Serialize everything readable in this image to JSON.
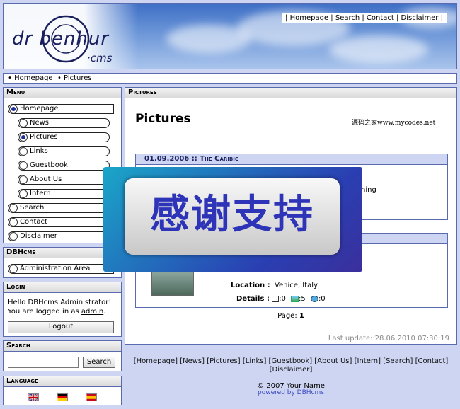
{
  "logo": {
    "text": "dr benhur",
    "suffix": "·cms"
  },
  "topnav": [
    "Homepage",
    "Search",
    "Contact",
    "Disclaimer"
  ],
  "breadcrumb": [
    "Homepage",
    "Pictures"
  ],
  "menu": {
    "title": "Menu",
    "items": [
      {
        "label": "Homepage",
        "level": 0,
        "selected": true
      },
      {
        "label": "News",
        "level": 1,
        "selected": false
      },
      {
        "label": "Pictures",
        "level": 1,
        "selected": true
      },
      {
        "label": "Links",
        "level": 1,
        "selected": false
      },
      {
        "label": "Guestbook",
        "level": 1,
        "selected": false
      },
      {
        "label": "About Us",
        "level": 1,
        "selected": false
      },
      {
        "label": "Intern",
        "level": 1,
        "selected": false
      },
      {
        "label": "Search",
        "level": 0,
        "selected": false
      },
      {
        "label": "Contact",
        "level": 0,
        "selected": false
      },
      {
        "label": "Disclaimer",
        "level": 0,
        "selected": false
      }
    ]
  },
  "dbhcms": {
    "title": "DBHcms",
    "item": "Administration Area"
  },
  "login": {
    "title": "Login",
    "greeting": "Hello DBHcms Administrator!",
    "logged_prefix": "You are logged in as",
    "user": "admin",
    "logout": "Logout"
  },
  "search": {
    "title": "Search",
    "button": "Search",
    "value": ""
  },
  "language": {
    "title": "Language",
    "flags": [
      "uk-flag",
      "germany-flag",
      "spain-flag"
    ]
  },
  "content": {
    "header": "Pictures",
    "title": "Pictures",
    "watermark": "源码之家www.mycodes.net",
    "album1": {
      "date": "01.09.2006",
      "name": "The Caribic",
      "text": "ning"
    },
    "album2": {
      "location_label": "Location :",
      "location": "Venice, Italy",
      "details_label": "Details :",
      "comments": ":0",
      "pictures": ":5",
      "views": ":0"
    },
    "page_label": "Page:",
    "page_num": "1",
    "last_update": "Last update: 28.06.2010 07:30:19"
  },
  "overlay": {
    "text": "感谢支持"
  },
  "footer": {
    "links": [
      "Homepage",
      "News",
      "Pictures",
      "Links",
      "Guestbook",
      "About Us",
      "Intern",
      "Search",
      "Contact",
      "Disclaimer"
    ],
    "copyright": "© 2007 Your Name",
    "powered": "powered by DBHcms"
  },
  "colors": {
    "border": "#5a6aae",
    "background": "#cdd5f2",
    "accent": "#1e2e9a"
  }
}
